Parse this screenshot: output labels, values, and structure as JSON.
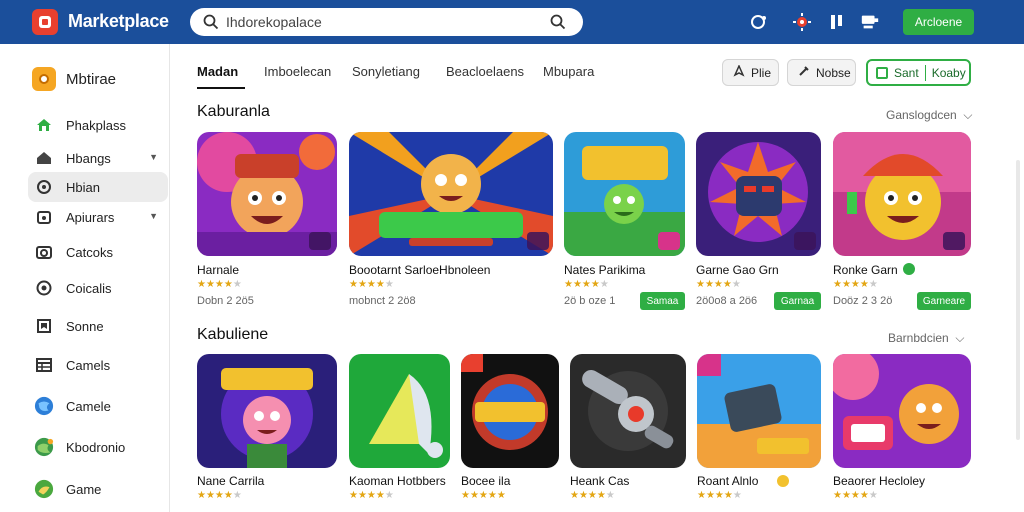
{
  "header": {
    "app_title": "Marketplace",
    "search_placeholder": "Ihdorekopalace",
    "cta_label": "Arcloene"
  },
  "sidebar": {
    "brand": "Mbtirae",
    "items": [
      {
        "label": "Phakplass",
        "icon": "home-icon"
      },
      {
        "label": "Hbangs",
        "icon": "house-icon"
      },
      {
        "label": "Hbian",
        "icon": "circle-icon",
        "active": true
      },
      {
        "label": "Apiurars",
        "icon": "lock-icon"
      },
      {
        "label": "Catcoks",
        "icon": "camera-icon"
      },
      {
        "label": "Coicalis",
        "icon": "clock-icon"
      },
      {
        "label": "Sonne",
        "icon": "bookmark-icon"
      },
      {
        "label": "Camels",
        "icon": "grid-icon"
      },
      {
        "label": "Camele",
        "icon": "globe-icon"
      },
      {
        "label": "Kbodronio",
        "icon": "map-icon"
      },
      {
        "label": "Game",
        "icon": "map-pin-icon"
      }
    ]
  },
  "tabs": [
    "Madan",
    "Imboelecan",
    "Sonyletiang",
    "Beacloelaens",
    "Mbupara"
  ],
  "actions": {
    "pill1": "Plie",
    "pill2": "Nobse",
    "green_left": "Sant",
    "green_right": "Koaby"
  },
  "sections": [
    {
      "title": "Kaburanla",
      "sort": "Ganslogdcen",
      "games": [
        {
          "title": "Harnale",
          "rating": 4,
          "meta": "Dobn 2 2ö5",
          "button": ""
        },
        {
          "title": "Boootarnt SarloeHbnoleen",
          "rating": 4,
          "meta": "mobnct 2 2ö8",
          "button": ""
        },
        {
          "title": "Nates Parikima",
          "rating": 4,
          "meta": "2ö b oze 1",
          "button": "Samaa"
        },
        {
          "title": "Garne Gao Grn",
          "rating": 4,
          "meta": "2ö0o8 a 2ö6",
          "button": "Garnaa"
        },
        {
          "title": "Ronke Garn",
          "rating": 4,
          "meta": "Doöz 2 3 2ö",
          "button": "Garneare"
        }
      ]
    },
    {
      "title": "Kabuliene",
      "sort": "Barnbdcien",
      "games": [
        {
          "title": "Nane Carrila",
          "rating": 4
        },
        {
          "title": "Kaoman Hotbbers",
          "rating": 4
        },
        {
          "title": "Bocee ila",
          "rating": 5
        },
        {
          "title": "Heank Cas",
          "rating": 4
        },
        {
          "title": "Roant Alnlo",
          "rating": 4
        },
        {
          "title": "Beaorer Hecloley",
          "rating": 4
        }
      ]
    }
  ],
  "colors": {
    "topbar": "#1b4f9b",
    "accent_green": "#2fae44",
    "star": "#e3a614"
  }
}
